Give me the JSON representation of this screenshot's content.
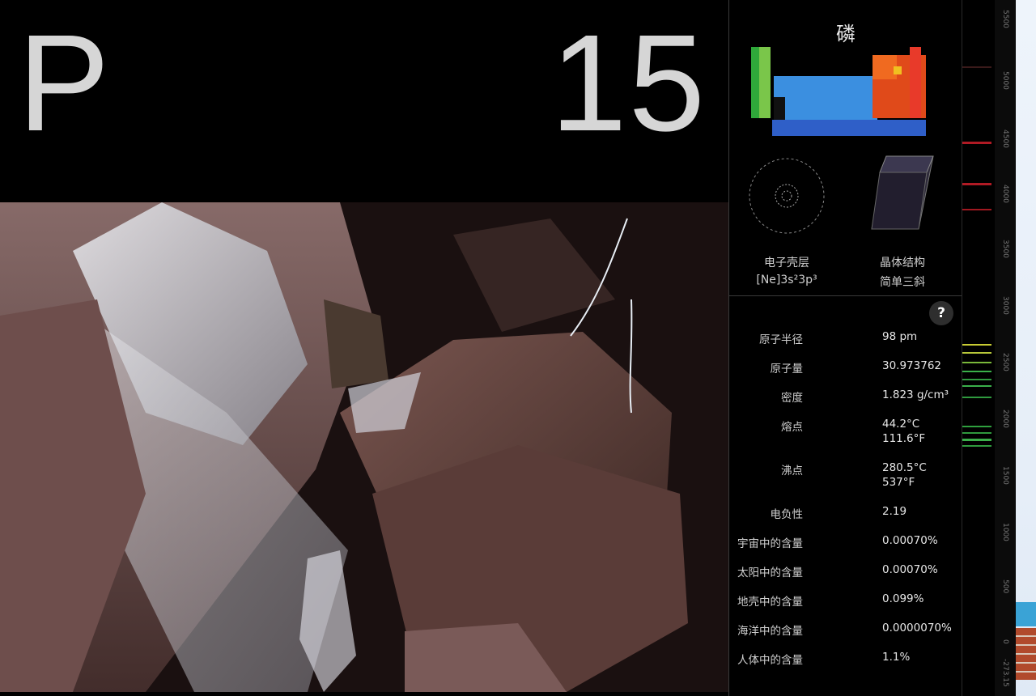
{
  "element": {
    "symbol": "P",
    "atomic_number": "15",
    "cn_name": "磷"
  },
  "mini_panels": {
    "shell_label": "电子壳层",
    "shell_config": "[Ne]3s²3p³",
    "crystal_label": "晶体结构",
    "crystal_value": "简单三斜"
  },
  "help_label": "?",
  "properties": [
    {
      "key": "原子半径",
      "value": "98 pm"
    },
    {
      "key": "原子量",
      "value": "30.973762"
    },
    {
      "key": "密度",
      "value": "1.823 g/cm³"
    },
    {
      "key": "熔点",
      "value": "44.2°C",
      "value2": "111.6°F"
    },
    {
      "key": "沸点",
      "value": "280.5°C",
      "value2": "537°F"
    },
    {
      "key": "电负性",
      "value": "2.19"
    },
    {
      "key": "宇宙中的含量",
      "value": "0.00070%"
    },
    {
      "key": "太阳中的含量",
      "value": "0.00070%"
    },
    {
      "key": "地壳中的含量",
      "value": "0.099%"
    },
    {
      "key": "海洋中的含量",
      "value": "0.0000070%"
    },
    {
      "key": "人体中的含量",
      "value": "1.1%"
    }
  ],
  "scale_ticks": [
    "5500",
    "5000",
    "4500",
    "4000",
    "3500",
    "3000",
    "2500",
    "2000",
    "1500",
    "1000",
    "500",
    "0",
    "-273.15"
  ],
  "colors": {
    "spectrum_red": "#c0202a",
    "spectrum_green": "#3ab04a",
    "spectrum_yellow": "#c8cc33"
  }
}
